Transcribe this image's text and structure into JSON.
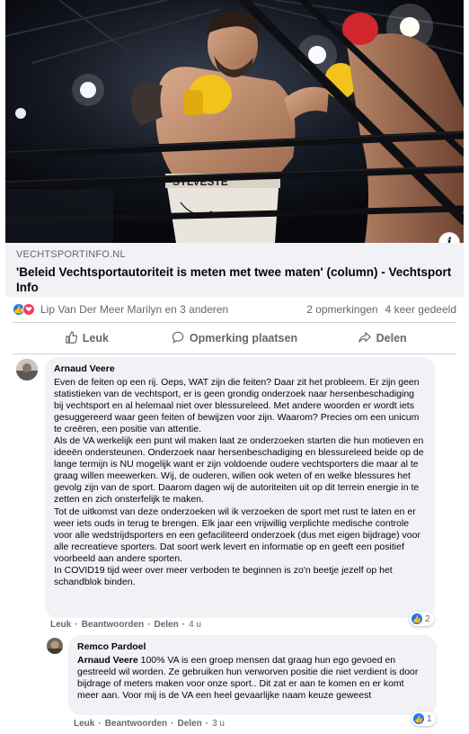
{
  "post": {
    "link": {
      "domain": "VECHTSPORTINFO.NL",
      "title": "'Beleid Vechtsportautoriteit is meten met twee maten' (column) - Vechtsport Info",
      "image_icon": "info-icon",
      "image_trunks_text": "SYLVESTE"
    },
    "reactions": {
      "icons": [
        "like-icon",
        "love-icon"
      ],
      "reactors": "Lip Van Der Meer Marilyn en 3 anderen",
      "comments_count": "2 opmerkingen",
      "shares_count": "4 keer gedeeld"
    },
    "actions": [
      {
        "label": "Leuk",
        "icon": "thumbs-up-icon"
      },
      {
        "label": "Opmerking plaatsen",
        "icon": "comment-icon"
      },
      {
        "label": "Delen",
        "icon": "share-icon"
      }
    ]
  },
  "comments": [
    {
      "author": "Arnaud Veere",
      "text": "Even de feiten op een rij. Oeps, WAT zijn die feiten? Daar zit het probleem. Er zijn geen statistieken van de vechtsport, er is geen grondig onderzoek naar hersenbeschadiging bij vechtsport en al helemaal niet over blessureleed. Met andere woorden er wordt iets gesuggereerd waar geen feiten of bewijzen voor zijn. Waarom? Precies om een unicum te creëren, een positie van attentie.\nAls de VA werkelijk een punt wil maken laat ze onderzoeken starten die hun motieven en ideeën ondersteunen. Onderzoek naar hersenbeschadiging en blessureleed beide op de lange termijn is NU mogelijk want er zijn voldoende oudere vechtsporters die maar al te graag willen meewerken. Wij, de ouderen, willen ook weten of en welke blessures het gevolg zijn van de sport. Daarom dagen wij de autoriteiten uit op dit terrein energie in te zetten en zich onsterfelijk te maken.\nTot de uitkomst van deze onderzoeken wil ik verzoeken de sport met rust te laten en er weer iets ouds in terug te brengen. Elk jaar een vrijwillig verplichte medische controle voor alle wedstrijdsporters en een gefaciliteerd onderzoek (dus met eigen bijdrage) voor alle recreatieve sporters. Dat soort werk levert en informatie op en geeft een positief voorbeeld aan andere sporten.\nIn COVID19 tijd weer over meer verboden te beginnen is zo'n beetje jezelf op het schandblok binden.",
      "meta": {
        "like": "Leuk",
        "reply": "Beantwoorden",
        "share": "Delen",
        "time": "4 u"
      },
      "likes": "2"
    },
    {
      "author": "Remco Pardoel",
      "mention": "Arnaud Veere",
      "text": " 100% VA is een groep mensen dat graag hun ego gevoed en gestreeld wil worden. Ze gebruiken hun verworven positie die niet verdient is door bijdrage of meters maken voor onze sport.. Dit zat er aan te komen en er komt meer aan. Voor mij is de VA een heel gevaarlijke naam keuze geweest",
      "meta": {
        "like": "Leuk",
        "reply": "Beantwoorden",
        "share": "Delen",
        "time": "3 u"
      },
      "likes": "1"
    }
  ],
  "colors": {
    "like_blue": "#1877f2",
    "love_red": "#f33e58",
    "bubble_bg": "#f0f2f5",
    "secondary_text": "#65676b"
  }
}
